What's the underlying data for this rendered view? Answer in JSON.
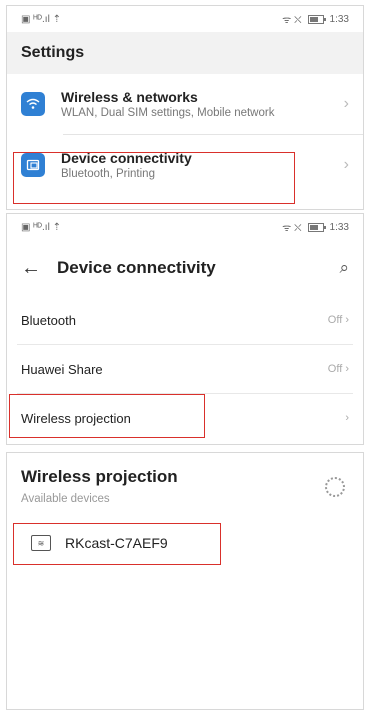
{
  "panel1": {
    "status": {
      "left": "▣ ᴴᴰ.ıl ⇡",
      "time": "1:33",
      "right_icons": "ᯤ ⛌"
    },
    "title": "Settings",
    "items": [
      {
        "label": "Wireless & networks",
        "sub": "WLAN, Dual SIM settings, Mobile network",
        "icon": "wifi-icon"
      },
      {
        "label": "Device connectivity",
        "sub": "Bluetooth, Printing",
        "icon": "device-connectivity-icon"
      }
    ],
    "chevron": "›"
  },
  "panel2": {
    "status": {
      "left": "▣ ᴴᴰ.ıl ⇡",
      "time": "1:33",
      "right_icons": "ᯤ ⛌"
    },
    "back": "←",
    "title": "Device connectivity",
    "search": "⌕",
    "items": [
      {
        "label": "Bluetooth",
        "value": "Off ›"
      },
      {
        "label": "Huawei Share",
        "value": "Off ›"
      },
      {
        "label": "Wireless projection",
        "value": "›"
      }
    ]
  },
  "panel3": {
    "title": "Wireless projection",
    "subtitle": "Available devices",
    "device": "RKcast-C7AEF9"
  },
  "colors": {
    "highlight": "#d9302b",
    "accent_icon": "#2f80d4"
  }
}
